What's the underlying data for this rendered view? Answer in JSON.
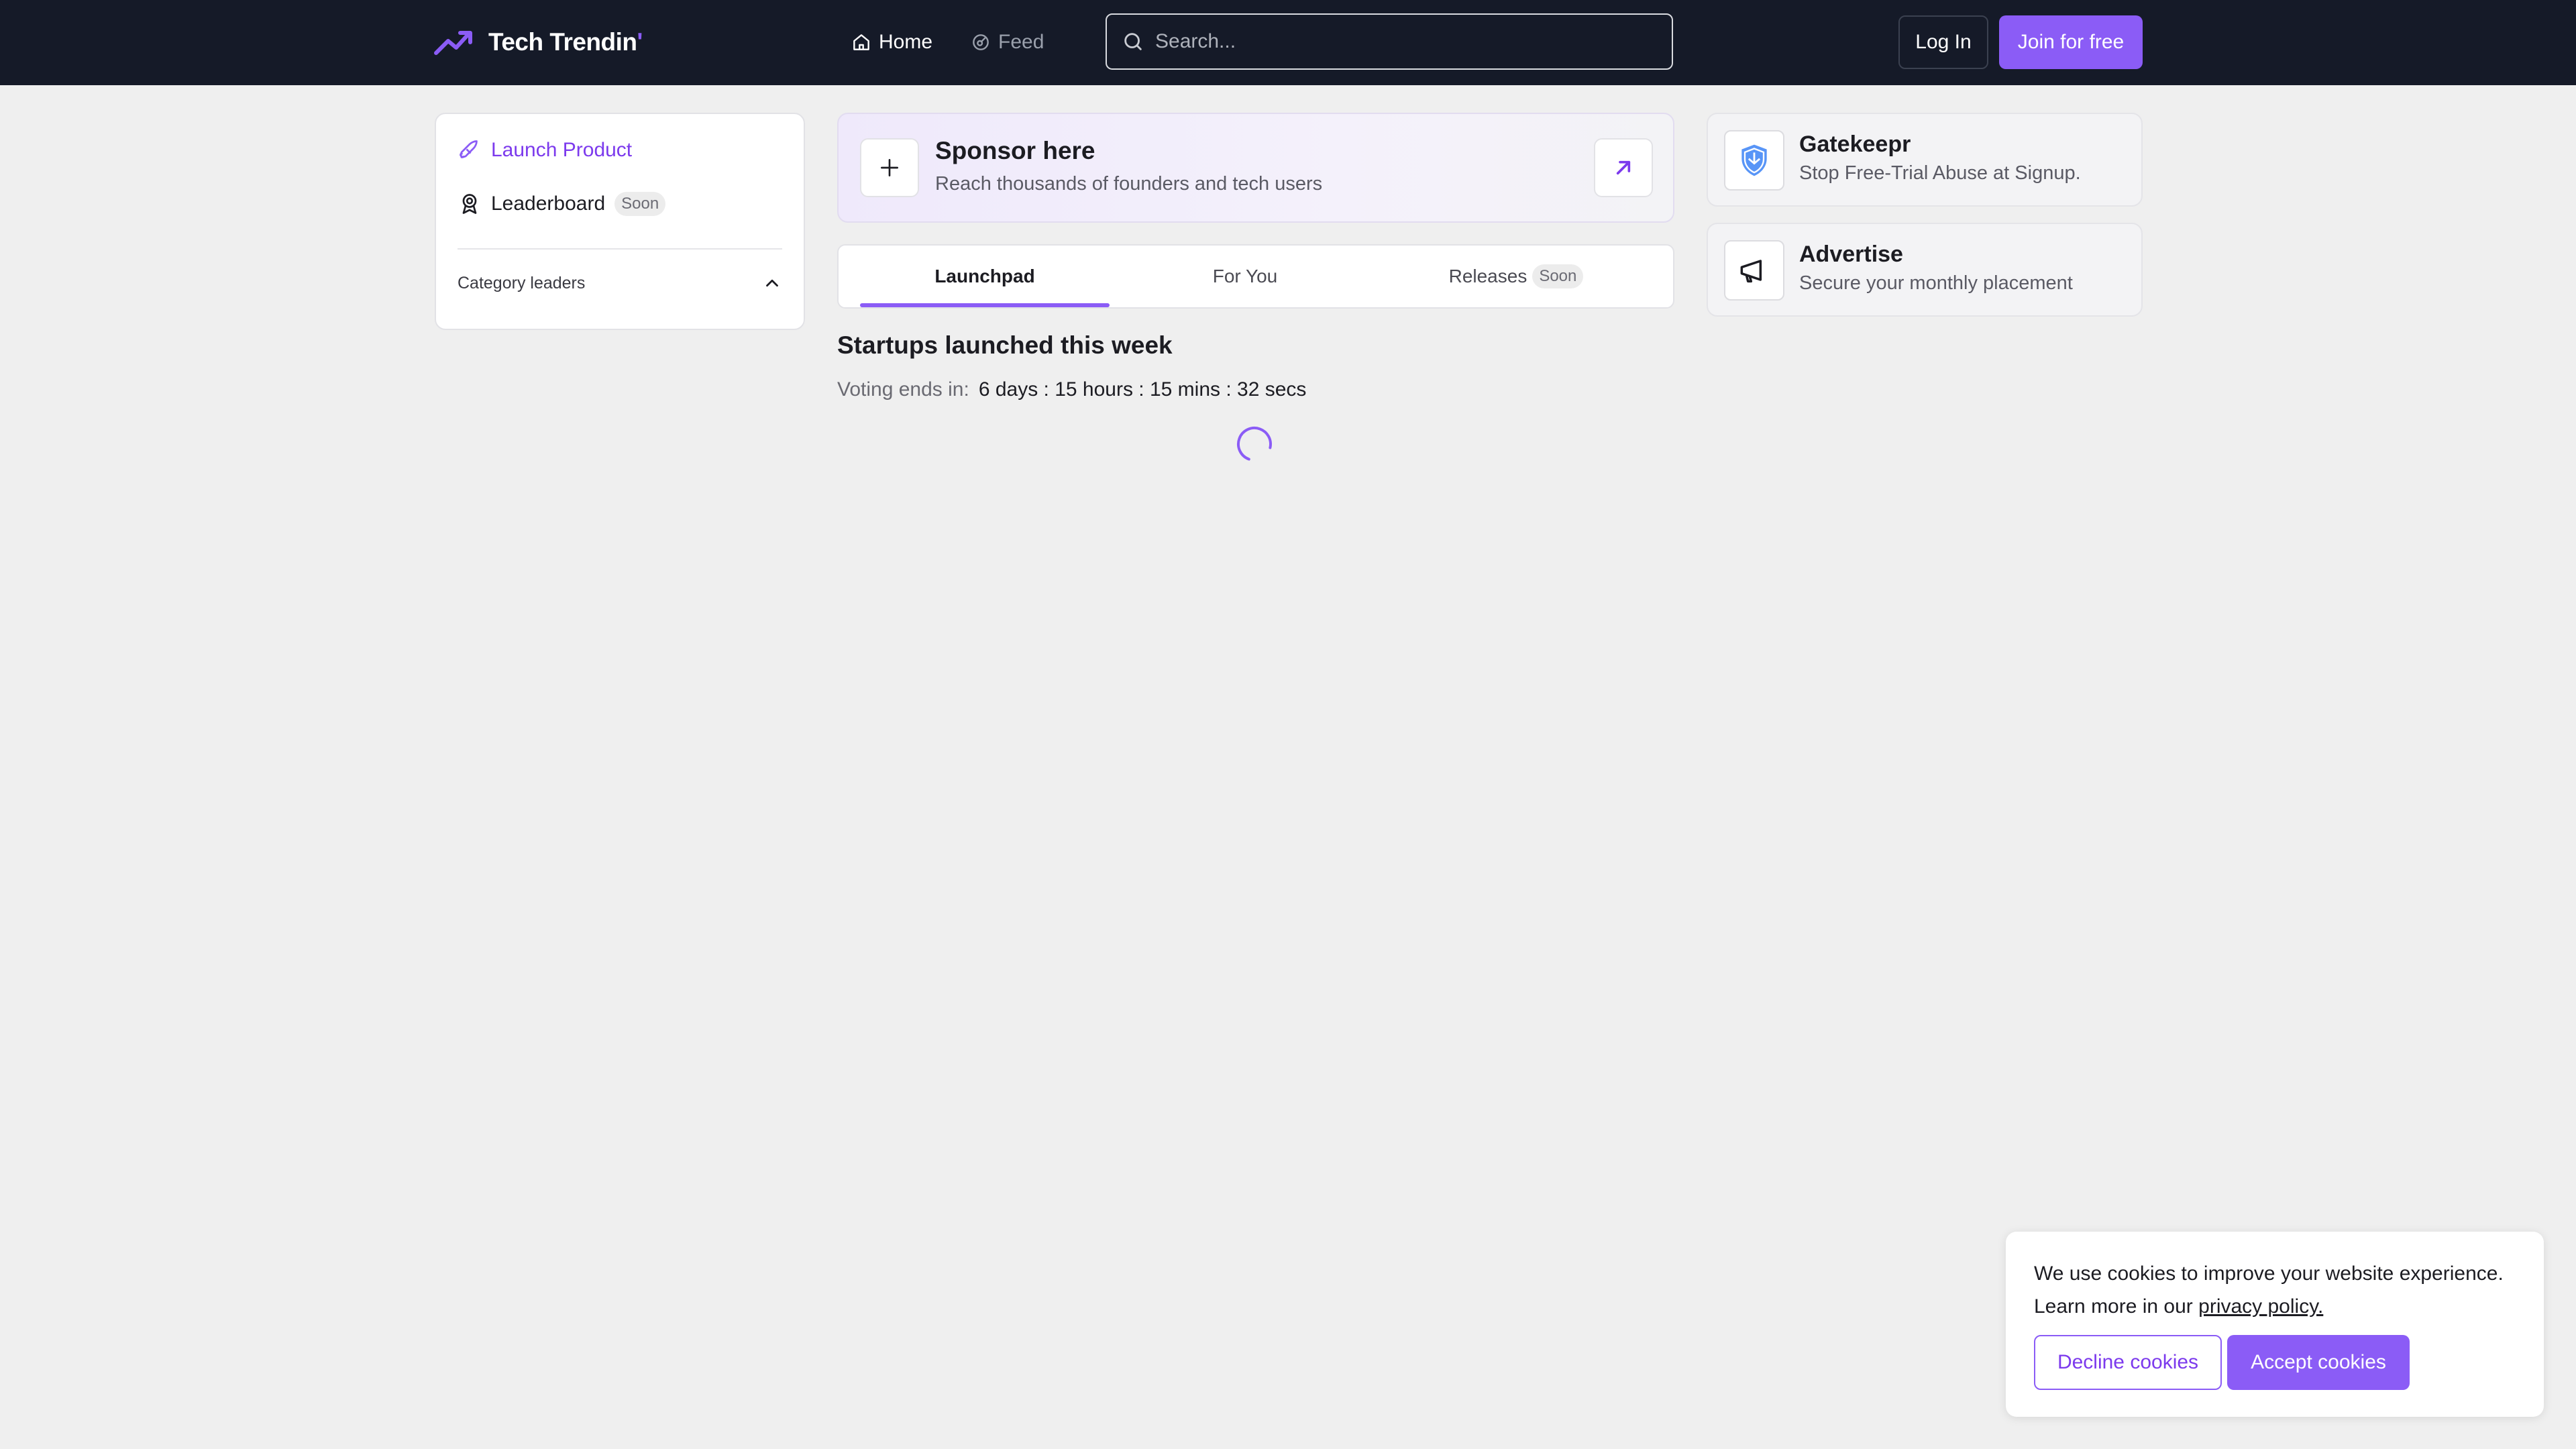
{
  "brand": {
    "name": "Tech Trendin",
    "mark": "'",
    "accent": "#8b5cf6",
    "topbar_bg": "#151a28"
  },
  "nav": {
    "home": "Home",
    "feed": "Feed"
  },
  "search": {
    "placeholder": "Search..."
  },
  "auth": {
    "login": "Log In",
    "join": "Join for free"
  },
  "sidebar": {
    "launch": "Launch Product",
    "leaderboard": "Leaderboard",
    "leaderboard_badge": "Soon",
    "category_leaders": "Category leaders"
  },
  "sponsor": {
    "title": "Sponsor here",
    "subtitle": "Reach thousands of founders and tech users"
  },
  "tabs": {
    "launchpad": "Launchpad",
    "for_you": "For You",
    "releases": "Releases",
    "releases_badge": "Soon"
  },
  "main": {
    "section_title": "Startups launched this week",
    "voting_label": "Voting ends in:",
    "countdown": "6 days : 15 hours : 15 mins : 32 secs"
  },
  "ads": [
    {
      "title": "Gatekeepr",
      "subtitle": "Stop Free-Trial Abuse at Signup.",
      "icon": "shield-icon"
    },
    {
      "title": "Advertise",
      "subtitle": "Secure your monthly placement",
      "icon": "megaphone-icon"
    }
  ],
  "cookie": {
    "text": "We use cookies to improve your website experience. Learn more in our",
    "link": "privacy policy.",
    "decline": "Decline cookies",
    "accept": "Accept cookies"
  }
}
